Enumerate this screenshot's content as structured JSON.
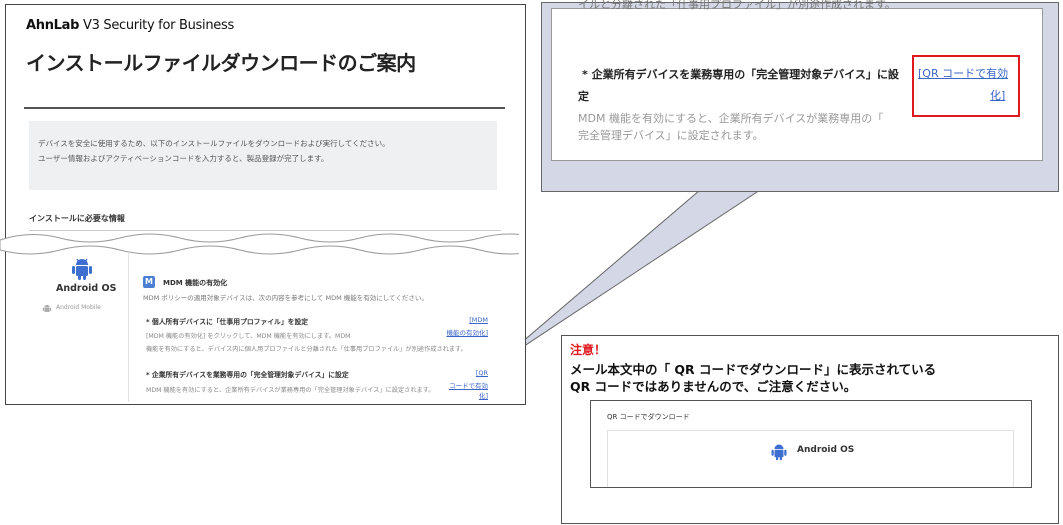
{
  "email": {
    "brand_prefix": "AhnLab",
    "brand_rest": " V3 Security for Business",
    "title": "インストールファイルダウンロードのご案内",
    "notice_line1": "デバイスを安全に使用するため、以下のインストールファイルをダウンロードおよび実行してください。",
    "notice_line2": "ユーザー情報およびアクティベーションコードを入力すると、製品登録が完了します。",
    "required_info_heading": "インストールに必要な情報",
    "platform": {
      "name": "Android OS",
      "sub": "Android Mobile",
      "icon": "android-icon"
    },
    "mdm": {
      "badge": "M",
      "title": "MDM 機能の有効化",
      "desc": "MDM ポリシーの適用対象デバイスは、次の内容を参考にして MDM 機能を有効にしてください。",
      "items": [
        {
          "title": "* 個人所有デバイスに「仕事用プロファイル」を設定",
          "desc1": "[MDM 機能の有効化] をクリックして、MDM 機能を有効にします。MDM",
          "desc2": "機能を有効にすると、デバイス内に個人用プロファイルと分離された「仕事用プロファイル」が別途作成されます。",
          "link1": "[MDM",
          "link2": "機能の有効化]"
        },
        {
          "title": "* 企業所有デバイスを業務専用の「完全管理対象デバイス」に設定",
          "desc1": "MDM 機能を有効にすると、企業所有デバイスが業務専用の「完全管理対象デバイス」に設定されます。",
          "link1": "[QR",
          "link2": "コードで有効化]"
        }
      ]
    }
  },
  "zoom": {
    "cut_text": "イルと分離された「仕事用プロファイル」が別途作成されます。",
    "title_line1": "* 企業所有デバイスを業務専用の「完全管理対象デバイス」に設",
    "title_line2": "定",
    "desc_line1": "MDM 機能を有効にすると、企業所有デバイスが業務専用の「",
    "desc_line2": "完全管理デバイス」に設定されます。",
    "link_line1": "[QR コードで有効",
    "link_line2": "化]"
  },
  "warning": {
    "label": "注意！",
    "line1": "メール本文中の「 QR コードでダウンロード」に表示されている",
    "line2": "QR コードではありませんので、ご注意ください。",
    "qr_section_title": "QR コードでダウンロード",
    "qr_platform": "Android OS"
  },
  "colors": {
    "link": "#3a66c9",
    "warning_red": "#e0191f",
    "callout_bg": "#d3d7e6",
    "badge_blue": "#4a7fd4",
    "android_blue": "#3d6fd1"
  }
}
